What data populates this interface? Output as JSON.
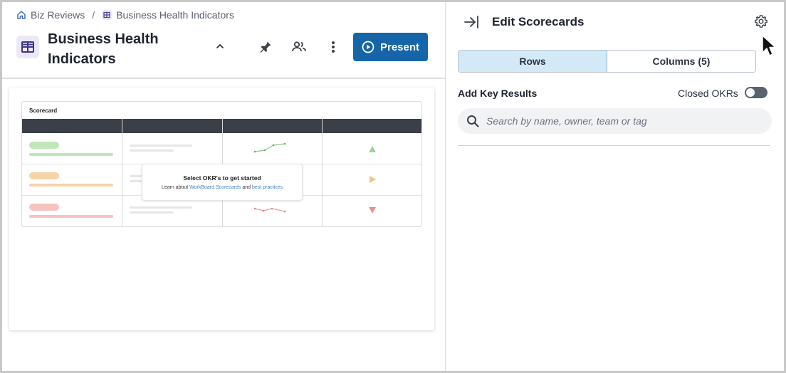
{
  "breadcrumb": {
    "items": [
      {
        "label": "Biz Reviews",
        "icon": "home-icon"
      },
      {
        "label": "Business Health Indicators",
        "icon": "table-icon"
      }
    ],
    "separator": "/"
  },
  "header": {
    "title": "Business Health Indicators",
    "present_label": "Present",
    "icons": [
      "chevron-up-icon",
      "pin-icon",
      "people-icon",
      "more-vertical-icon",
      "play-circle-icon"
    ]
  },
  "preview": {
    "scorecard_title": "Scorecard",
    "overlay_title": "Select OKR's to get started",
    "overlay_text_prefix": "Learn about ",
    "overlay_link1": "WorkBoard Scorecards",
    "overlay_text_mid": " and ",
    "overlay_link2": "best practices",
    "row_colors": {
      "green": "#bfe7b8",
      "orange": "#f7d3a8",
      "red": "#f5c3c0"
    }
  },
  "panel": {
    "title": "Edit Scorecards",
    "tabs": [
      {
        "label": "Rows",
        "active": true
      },
      {
        "label": "Columns (5)",
        "active": false
      }
    ],
    "add_key_results_label": "Add Key Results",
    "closed_okrs_label": "Closed OKRs",
    "closed_okrs_on": false,
    "search_placeholder": "Search by name, owner, team or tag",
    "icons": [
      "collapse-right-icon",
      "gear-icon",
      "search-icon"
    ]
  },
  "colors": {
    "primary": "#1565a8",
    "tab_active_bg": "#d3e9f8",
    "toggle_off": "#5a6270"
  }
}
